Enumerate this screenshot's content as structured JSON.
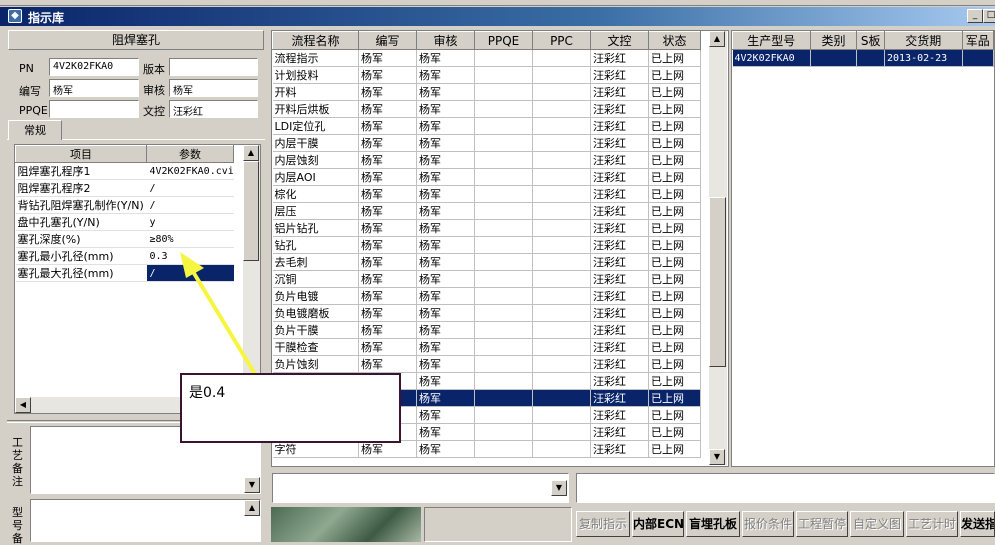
{
  "window": {
    "title": "指示库",
    "icon": "app-icon"
  },
  "left": {
    "section_title": "阻焊塞孔",
    "labels": {
      "pn": "PN",
      "version": "版本",
      "editor": "编写",
      "reviewer": "审核",
      "ppqe": "PPQE",
      "doc_control": "文控"
    },
    "values": {
      "pn": "4V2K02FKA0",
      "version": "",
      "editor": "杨军",
      "reviewer": "杨军",
      "ppqe": "",
      "doc_control": "汪彩红"
    },
    "tab": "常规",
    "param_headers": [
      "项目",
      "参数"
    ],
    "params": [
      {
        "item": "阻焊塞孔程序1",
        "value": "4V2K02FKA0.cvi"
      },
      {
        "item": "阻焊塞孔程序2",
        "value": "/"
      },
      {
        "item": "背钻孔阻焊塞孔制作(Y/N)",
        "value": "/"
      },
      {
        "item": "盘中孔塞孔(Y/N)",
        "value": "y"
      },
      {
        "item": "塞孔深度(%)",
        "value": "≥80%"
      },
      {
        "item": "塞孔最小孔径(mm)",
        "value": "0.3"
      },
      {
        "item": "塞孔最大孔径(mm)",
        "value": "/"
      }
    ],
    "remark_label": "工艺备注",
    "model_label": "型号备"
  },
  "flow": {
    "headers": [
      "流程名称",
      "编写",
      "审核",
      "PPQE",
      "PPC",
      "文控",
      "状态"
    ],
    "rows": [
      [
        "流程指示",
        "杨军",
        "杨军",
        "",
        "",
        "汪彩红",
        "已上网"
      ],
      [
        "计划投料",
        "杨军",
        "杨军",
        "",
        "",
        "汪彩红",
        "已上网"
      ],
      [
        "开料",
        "杨军",
        "杨军",
        "",
        "",
        "汪彩红",
        "已上网"
      ],
      [
        "开料后烘板",
        "杨军",
        "杨军",
        "",
        "",
        "汪彩红",
        "已上网"
      ],
      [
        "LDI定位孔",
        "杨军",
        "杨军",
        "",
        "",
        "汪彩红",
        "已上网"
      ],
      [
        "内层干膜",
        "杨军",
        "杨军",
        "",
        "",
        "汪彩红",
        "已上网"
      ],
      [
        "内层蚀刻",
        "杨军",
        "杨军",
        "",
        "",
        "汪彩红",
        "已上网"
      ],
      [
        "内层AOI",
        "杨军",
        "杨军",
        "",
        "",
        "汪彩红",
        "已上网"
      ],
      [
        "棕化",
        "杨军",
        "杨军",
        "",
        "",
        "汪彩红",
        "已上网"
      ],
      [
        "层压",
        "杨军",
        "杨军",
        "",
        "",
        "汪彩红",
        "已上网"
      ],
      [
        "铝片钻孔",
        "杨军",
        "杨军",
        "",
        "",
        "汪彩红",
        "已上网"
      ],
      [
        "钻孔",
        "杨军",
        "杨军",
        "",
        "",
        "汪彩红",
        "已上网"
      ],
      [
        "去毛刺",
        "杨军",
        "杨军",
        "",
        "",
        "汪彩红",
        "已上网"
      ],
      [
        "沉铜",
        "杨军",
        "杨军",
        "",
        "",
        "汪彩红",
        "已上网"
      ],
      [
        "负片电镀",
        "杨军",
        "杨军",
        "",
        "",
        "汪彩红",
        "已上网"
      ],
      [
        "负电镀磨板",
        "杨军",
        "杨军",
        "",
        "",
        "汪彩红",
        "已上网"
      ],
      [
        "负片干膜",
        "杨军",
        "杨军",
        "",
        "",
        "汪彩红",
        "已上网"
      ],
      [
        "干膜检查",
        "杨军",
        "杨军",
        "",
        "",
        "汪彩红",
        "已上网"
      ],
      [
        "负片蚀刻",
        "杨军",
        "杨军",
        "",
        "",
        "汪彩红",
        "已上网"
      ],
      [
        "",
        "",
        "杨军",
        "",
        "",
        "汪彩红",
        "已上网"
      ],
      [
        "",
        "",
        "杨军",
        "",
        "",
        "汪彩红",
        "已上网"
      ],
      [
        "",
        "",
        "杨军",
        "",
        "",
        "汪彩红",
        "已上网"
      ],
      [
        "",
        "",
        "杨军",
        "",
        "",
        "汪彩红",
        "已上网"
      ],
      [
        "字符",
        "杨军",
        "杨军",
        "",
        "",
        "汪彩红",
        "已上网"
      ]
    ],
    "selected_row": 20
  },
  "production": {
    "headers": [
      "生产型号",
      "类别",
      "S板",
      "交货期",
      "军品"
    ],
    "rows": [
      [
        "4V2K02FKA0",
        "",
        "",
        "2013-02-23",
        ""
      ]
    ]
  },
  "buttons": [
    {
      "label": "复制指示",
      "enabled": false
    },
    {
      "label": "内部ECN",
      "enabled": true
    },
    {
      "label": "盲埋孔板",
      "enabled": true
    },
    {
      "label": "报价条件",
      "enabled": false
    },
    {
      "label": "工程暂停",
      "enabled": false
    },
    {
      "label": "自定义图",
      "enabled": false
    },
    {
      "label": "工艺计时",
      "enabled": false
    },
    {
      "label": "发送指",
      "enabled": true
    }
  ],
  "annotation": {
    "text": "是0.4",
    "arrow_color": "#f5f542"
  }
}
